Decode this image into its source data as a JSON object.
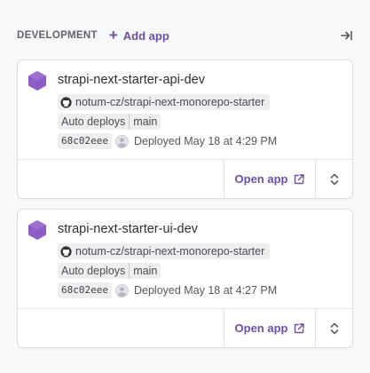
{
  "stage": {
    "title": "DEVELOPMENT",
    "add_app_label": "Add app",
    "collapse_icon": "arrow-right-to-bar-icon"
  },
  "apps": [
    {
      "name": "strapi-next-starter-api-dev",
      "repo": "notum-cz/strapi-next-monorepo-starter",
      "deploy_mode": "Auto deploys",
      "branch": "main",
      "commit": "68c02eee",
      "deployed": "Deployed May 18 at 4:29 PM",
      "open_label": "Open app"
    },
    {
      "name": "strapi-next-starter-ui-dev",
      "repo": "notum-cz/strapi-next-monorepo-starter",
      "deploy_mode": "Auto deploys",
      "branch": "main",
      "commit": "68c02eee",
      "deployed": "Deployed May 18 at 4:27 PM",
      "open_label": "Open app"
    }
  ],
  "colors": {
    "accent": "#6b4fa0",
    "app_icon": "#8d5cc4",
    "background": "#f7f8fa"
  }
}
